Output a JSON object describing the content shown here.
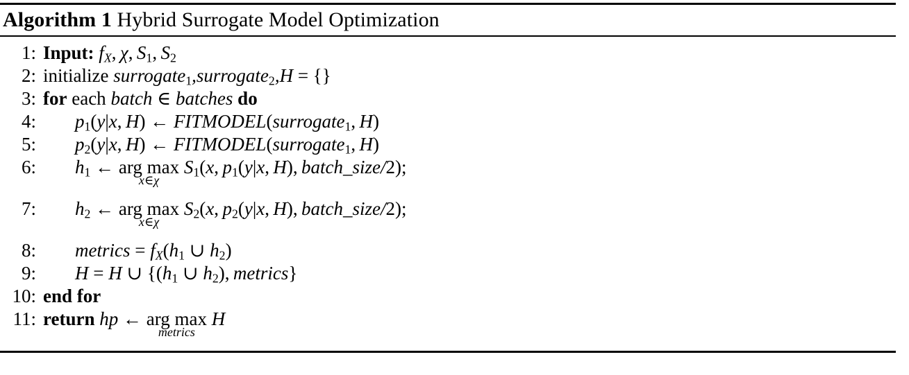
{
  "caption": {
    "label": "Algorithm 1",
    "title": "Hybrid Surrogate Model Optimization"
  },
  "lines": [
    {
      "number": "1:",
      "keyword": "Input:",
      "text": "f_X, χ, S_1, S_2",
      "indent": false
    },
    {
      "number": "2:",
      "keyword": "initialize",
      "text": "surrogate_1,surrogate_2,H = {}",
      "indent": false
    },
    {
      "number": "3:",
      "keyword": "for",
      "text": "each batch ∈ batches do",
      "indent": false
    },
    {
      "number": "4:",
      "keyword": "",
      "text": "p_1(y|x, H) ← FITMODEL(surrogate_1, H)",
      "indent": true
    },
    {
      "number": "5:",
      "keyword": "",
      "text": "p_2(y|x, H) ← FITMODEL(surrogate_1, H)",
      "indent": true
    },
    {
      "number": "6:",
      "keyword": "",
      "text": "h_1 ← arg max_{x∈χ} S_1(x, p_1(y|x, H), batch_size/2);",
      "indent": true
    },
    {
      "number": "7:",
      "keyword": "",
      "text": "h_2 ← arg max_{x∈χ} S_2(x, p_2(y|x, H), batch_size/2);",
      "indent": true
    },
    {
      "number": "8:",
      "keyword": "",
      "text": "metrics = f_X(h_1 ∪ h_2)",
      "indent": true
    },
    {
      "number": "9:",
      "keyword": "",
      "text": "H = H ∪ {(h_1 ∪ h_2), metrics}",
      "indent": true
    },
    {
      "number": "10:",
      "keyword": "end for",
      "text": "",
      "indent": false
    },
    {
      "number": "11:",
      "keyword": "return",
      "text": "hp ← arg max_{metrics} H",
      "indent": false
    }
  ],
  "tokens": {
    "input_kw": "Input:",
    "initialize_kw": "initialize",
    "for_kw": "for",
    "each_kw": "each",
    "do_kw": "do",
    "end_for_kw": "end for",
    "return_kw": "return",
    "fitmodel": "FITMODEL",
    "argmax": "arg max",
    "surrogate": "surrogate",
    "batch": "batch",
    "batches": "batches",
    "batch_size": "batch_size",
    "metrics": "metrics",
    "hp": "hp",
    "chi": "χ",
    "in": "∈",
    "cup": "∪",
    "gets": "←",
    "eq": "=",
    "comma": ",",
    "semicolon": ";",
    "lparen": "(",
    "rparen": ")",
    "lbrace": "{",
    "rbrace": "}",
    "empty_set_braces": "{}",
    "bar": "|",
    "slash": "/",
    "two": "2",
    "var_f": "f",
    "var_X": "X",
    "var_S": "S",
    "var_p": "p",
    "var_h": "h",
    "var_H": "H",
    "var_x": "x",
    "var_y": "y",
    "sub_1": "1",
    "sub_2": "2",
    "num_1": "1:",
    "num_2": "2:",
    "num_3": "3:",
    "num_4": "4:",
    "num_5": "5:",
    "num_6": "6:",
    "num_7": "7:",
    "num_8": "8:",
    "num_9": "9:",
    "num_10": "10:",
    "num_11": "11:"
  },
  "colors": {
    "text": "#000000",
    "background": "#ffffff",
    "rule": "#000000"
  }
}
